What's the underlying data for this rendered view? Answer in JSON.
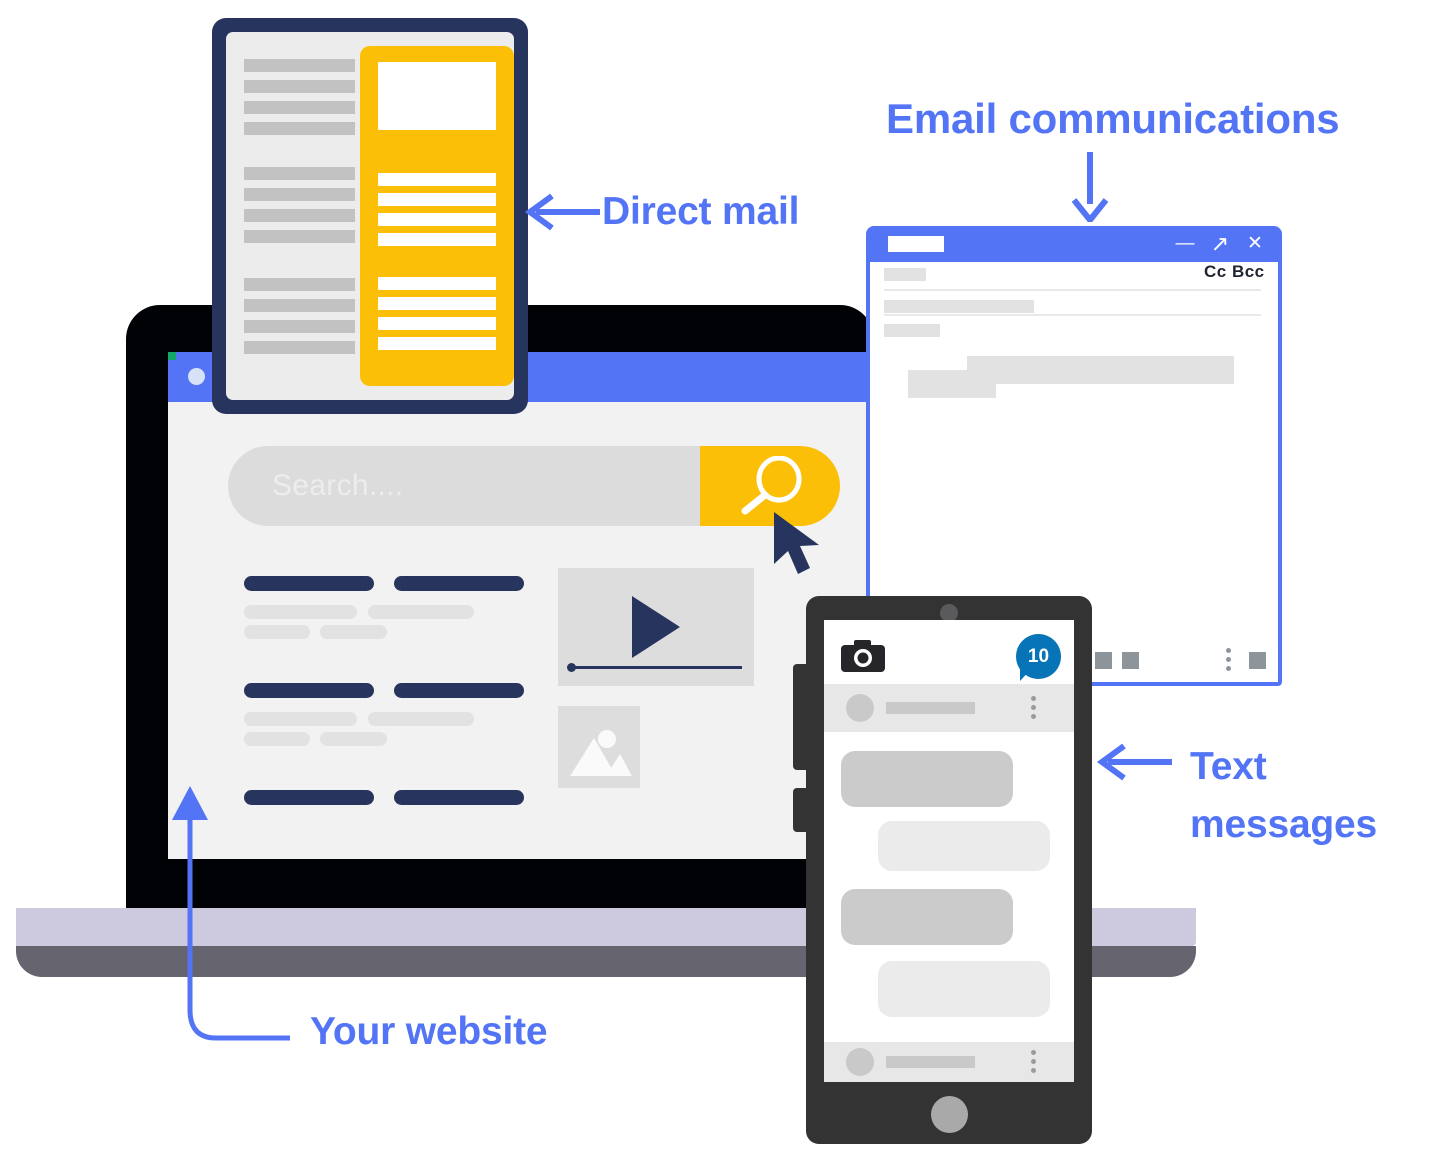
{
  "title": "Marketing channels illustration",
  "colors": {
    "accent_blue": "#5274f5",
    "navy": "#26345e",
    "yellow": "#fcbf08",
    "badge_blue": "#0874b8",
    "laptop_black": "#000205",
    "laptop_base_top": "#cdcae0",
    "laptop_base_bottom": "#66646f",
    "phone_body": "#333334",
    "screen_bg": "#f2f2f3",
    "skeleton_gray": "#c2c2c2"
  },
  "annotations": [
    {
      "id": "email",
      "label": "Email communications",
      "arrow": "down-arrow-icon",
      "target": "email-window"
    },
    {
      "id": "direct-mail",
      "label": "Direct mail",
      "arrow": "left-arrow-icon",
      "target": "direct-mail-document"
    },
    {
      "id": "text-messages",
      "label_line1": "Text",
      "label_line2": "messages",
      "arrow": "left-arrow-icon",
      "target": "phone"
    },
    {
      "id": "your-website",
      "label": "Your website",
      "arrow": "curved-up-arrow-icon",
      "target": "laptop-screen"
    }
  ],
  "laptop": {
    "titlebar_dot": "window-dot",
    "search": {
      "placeholder": "Search....",
      "button_icon": "magnifier-icon"
    },
    "cursor": "cursor-arrow-icon",
    "content_rows": [
      {
        "headings": 2,
        "text_lines": 4
      },
      {
        "headings": 2,
        "text_lines": 4
      },
      {
        "headings": 2,
        "text_lines": 0
      }
    ],
    "media": {
      "video": {
        "icon": "play-triangle-icon",
        "progress_percent": 2
      },
      "image": {
        "icon": "image-placeholder-icon"
      }
    }
  },
  "direct_mail": {
    "left_column_groups": 3,
    "lines_per_group": 4,
    "panel": {
      "image_block": true,
      "line_groups": 2,
      "lines_per_group": 4
    }
  },
  "email_window": {
    "titlebar": {
      "title_block": true,
      "buttons": [
        {
          "name": "minimize",
          "glyph": "—"
        },
        {
          "name": "expand",
          "glyph": "↗"
        },
        {
          "name": "close",
          "glyph": "✕"
        }
      ]
    },
    "cc_bcc_label": "Cc Bcc",
    "field_rows": 3,
    "body_lines": 3,
    "footer": {
      "left_icons": [
        "square-icon",
        "square-icon"
      ],
      "more_icon": "more-vertical-icon",
      "right_icon": "square-icon"
    }
  },
  "phone": {
    "camera_icon": "camera-icon",
    "unread_badge": "10",
    "badge_icon": "message-bubble-icon",
    "home_button": "home-button",
    "contact_rows": [
      {
        "avatar": "avatar-icon",
        "menu": "more-vertical-icon"
      },
      {
        "avatar": "avatar-icon",
        "menu": "more-vertical-icon"
      }
    ],
    "message_bubbles": [
      {
        "side": "left",
        "tone": "dark"
      },
      {
        "side": "right",
        "tone": "light"
      },
      {
        "side": "left",
        "tone": "dark"
      },
      {
        "side": "right",
        "tone": "light"
      }
    ]
  }
}
